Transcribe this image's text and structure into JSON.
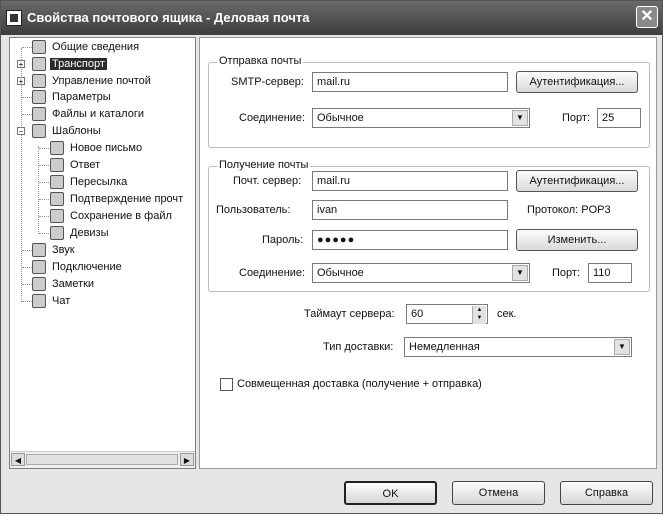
{
  "window": {
    "title": "Свойства почтового ящика - Деловая почта"
  },
  "tree": {
    "items": [
      {
        "label": "Общие сведения"
      },
      {
        "label": "Транспорт"
      },
      {
        "label": "Управление почтой"
      },
      {
        "label": "Параметры"
      },
      {
        "label": "Файлы и каталоги"
      },
      {
        "label": "Шаблоны"
      },
      {
        "label": "Новое письмо"
      },
      {
        "label": "Ответ"
      },
      {
        "label": "Пересылка"
      },
      {
        "label": "Подтверждение прочт"
      },
      {
        "label": "Сохранение в файл"
      },
      {
        "label": "Девизы"
      },
      {
        "label": "Звук"
      },
      {
        "label": "Подключение"
      },
      {
        "label": "Заметки"
      },
      {
        "label": "Чат"
      }
    ]
  },
  "send": {
    "legend": "Отправка почты",
    "smtp_label": "SMTP-сервер:",
    "smtp_value": "mail.ru",
    "auth_button": "Аутентификация...",
    "conn_label": "Соединение:",
    "conn_value": "Обычное",
    "port_label": "Порт:",
    "port_value": "25"
  },
  "receive": {
    "legend": "Получение почты",
    "server_label": "Почт. сервер:",
    "server_value": "mail.ru",
    "auth_button": "Аутентификация...",
    "user_label": "Пользователь:",
    "user_value": "ivan",
    "protocol_text": "Протокол: POP3",
    "password_label": "Пароль:",
    "password_value": "●●●●●",
    "change_button": "Изменить...",
    "conn_label": "Соединение:",
    "conn_value": "Обычное",
    "port_label": "Порт:",
    "port_value": "110"
  },
  "timeout": {
    "label": "Таймаут сервера:",
    "value": "60",
    "unit": "сек."
  },
  "delivery": {
    "label": "Тип доставки:",
    "value": "Немедленная"
  },
  "combined": {
    "label": "Совмещенная доставка (получение + отправка)",
    "checked": false
  },
  "buttons": {
    "ok": "OK",
    "cancel": "Отмена",
    "help": "Справка"
  }
}
